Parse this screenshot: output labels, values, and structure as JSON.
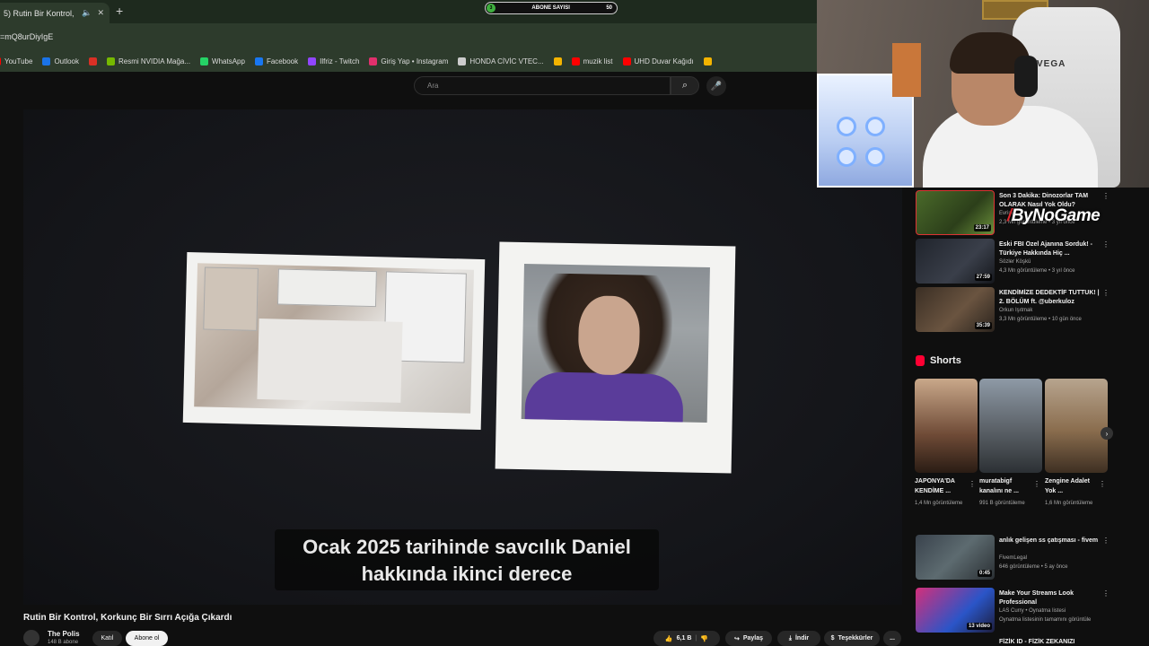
{
  "browser": {
    "tab_title": "5) Rutin Bir Kontrol, Kork",
    "new_tab_label": "+",
    "url": "=mQ8urDiyIgE",
    "bookmarks": [
      {
        "label": "YouTube",
        "color": "#ff0000"
      },
      {
        "label": "Outlook",
        "color": "#1a73e8"
      },
      {
        "label": "",
        "color": "#d93025"
      },
      {
        "label": "Resmi NVIDIA Mağa...",
        "color": "#76b900"
      },
      {
        "label": "WhatsApp",
        "color": "#25d366"
      },
      {
        "label": "Facebook",
        "color": "#1877f2"
      },
      {
        "label": "Ilfriz - Twitch",
        "color": "#9146ff"
      },
      {
        "label": "Giriş Yap • Instagram",
        "color": "#e1306c"
      },
      {
        "label": "HONDA CİVİC VTEC...",
        "color": "#cccccc"
      },
      {
        "label": "",
        "color": "#f4b400"
      },
      {
        "label": "muzik list",
        "color": "#ff0000"
      },
      {
        "label": "UHD Duvar Kağıdı",
        "color": "#ff0000"
      },
      {
        "label": "",
        "color": "#f4b400"
      }
    ]
  },
  "stream_overlay": {
    "sub_label": "ABONE SAYISI",
    "sub_current": "3",
    "sub_goal": "50",
    "brand": "ByNoGame"
  },
  "youtube": {
    "search_placeholder": "Ara",
    "video": {
      "subtitle_line1": "Ocak 2025 tarihinde savcılık Daniel",
      "subtitle_line2": "hakkında ikinci derece",
      "title": "Rutin Bir Kontrol, Korkunç Bir Sırrı Açığa Çıkardı",
      "channel_name": "The Polis",
      "channel_subs": "148 B abone",
      "join_label": "Katıl",
      "subscribe_label": "Abone ol",
      "likes": "6,1 B",
      "share_label": "Paylaş",
      "download_label": "İndir",
      "thanks_label": "Teşekkürler",
      "more_label": "..."
    },
    "sidebar": {
      "videos": [
        {
          "title": "Son 3 Dakika: Dinozorlar TAM OLARAK Nasıl Yok Oldu?",
          "channel": "Evrim",
          "meta": "2,3 Mn görüntüleme • 3 yıl önce",
          "duration": "23:17"
        },
        {
          "title": "Eski FBI Özel Ajanına Sorduk! - Türkiye Hakkında Hiç ...",
          "channel": "Sözler Köşkü",
          "meta": "4,3 Mn görüntüleme • 3 yıl önce",
          "duration": "27:59"
        },
        {
          "title": "KENDİMİZE DEDEKTİF TUTTUK! | 2. BÖLÜM ft. @uberkuloz",
          "channel": "Orkun Işıtmak",
          "meta": "3,3 Mn görüntüleme • 10 gün önce",
          "duration": "35:39"
        },
        {
          "title": "anlık gelişen ss çatışması - fivem",
          "channel": "FivemLegal",
          "meta": "646 görüntüleme • 5 ay önce",
          "duration": "0:45"
        },
        {
          "title": "Make Your Streams Look Professional",
          "channel": "LAS Curry • Oynatma listesi",
          "meta": "Oynatma listesinin tamamını görüntüle",
          "duration": "13 video"
        },
        {
          "title": "FİZİK ID - FİZİK ZEKANIZI",
          "channel": "",
          "meta": "",
          "duration": ""
        }
      ],
      "shorts_header": "Shorts",
      "shorts": [
        {
          "title": "JAPONYA'DA KENDİME ...",
          "views": "1,4 Mn görüntüleme"
        },
        {
          "title": "muratabigf kanalını ne ...",
          "views": "991 B görüntüleme"
        },
        {
          "title": "Zengine Adalet Yok ...",
          "views": "1,6 Mn görüntüleme"
        }
      ]
    }
  }
}
